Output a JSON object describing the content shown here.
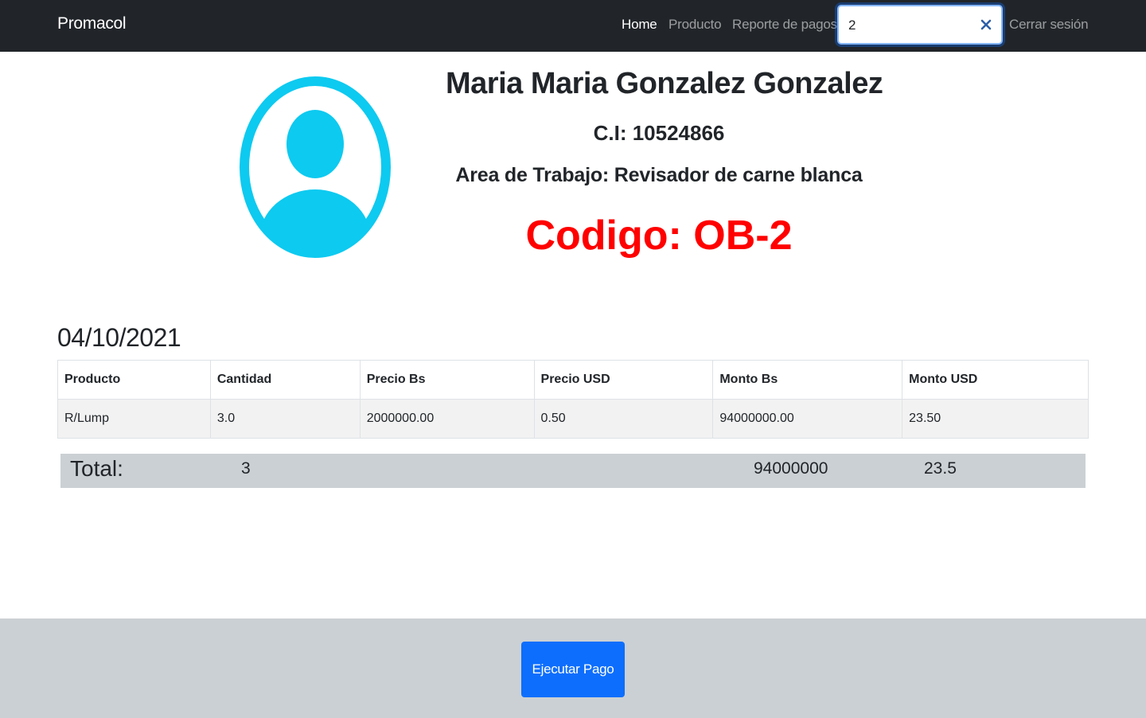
{
  "navbar": {
    "brand": "Promacol",
    "links": [
      {
        "label": "Home",
        "active": true
      },
      {
        "label": "Producto",
        "active": false
      },
      {
        "label": "Reporte de pagos",
        "active": false
      }
    ],
    "search": {
      "value": "2",
      "clear_icon": "close-icon"
    },
    "logout_label": "Cerrar sesión"
  },
  "profile": {
    "avatar_icon": "user-avatar-icon",
    "avatar_color": "#0dcaf0",
    "name": "Maria Maria Gonzalez Gonzalez",
    "ci": "C.I: 10524866",
    "area": "Area de Trabajo: Revisador de carne blanca",
    "code": "Codigo: OB-2",
    "code_color": "#ff0000"
  },
  "report": {
    "date": "04/10/2021",
    "columns": [
      "Producto",
      "Cantidad",
      "Precio Bs",
      "Precio USD",
      "Monto Bs",
      "Monto USD"
    ],
    "rows": [
      [
        "R/Lump",
        "3.0",
        "2000000.00",
        "0.50",
        "94000000.00",
        "23.50"
      ]
    ],
    "totals": {
      "label": "Total:",
      "cantidad": "3",
      "monto_bs": "94000000",
      "monto_usd": "23.5"
    }
  },
  "footer": {
    "pay_button_label": "Ejecutar Pago",
    "button_color": "#0d6efd"
  }
}
